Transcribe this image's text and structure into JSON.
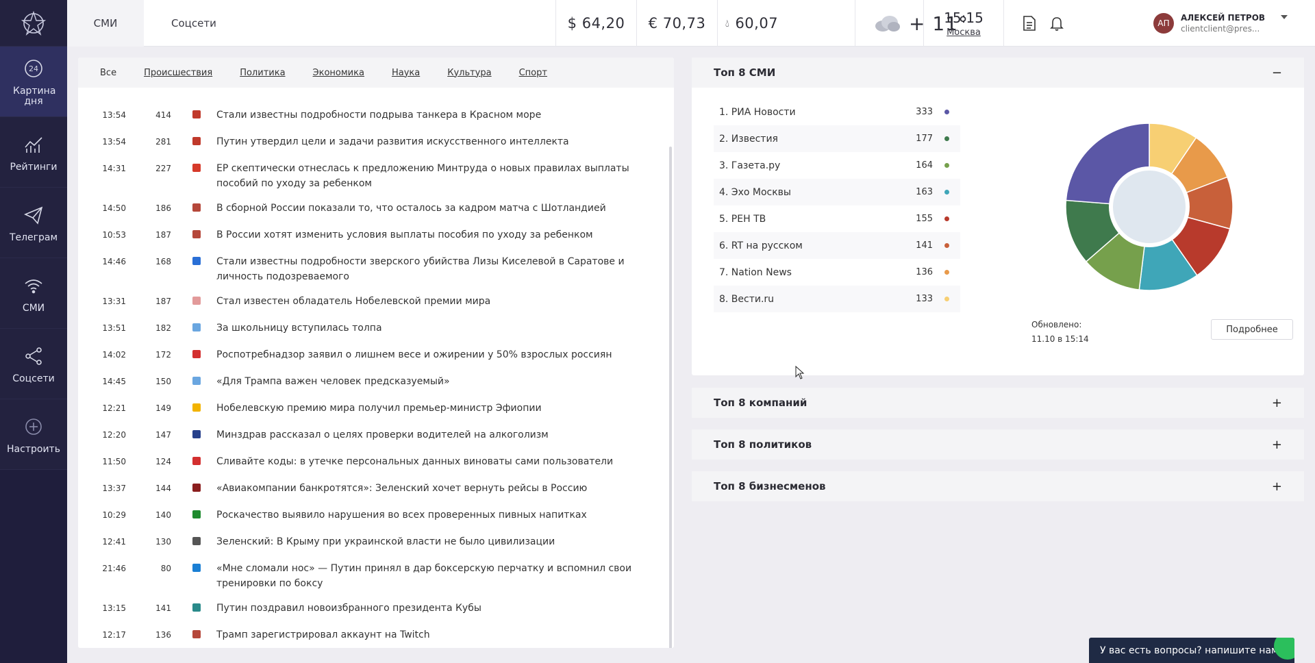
{
  "sidebar": {
    "items": [
      {
        "label": "Картина дня",
        "icon": "clock-24-icon",
        "active": true
      },
      {
        "label": "Рейтинги",
        "icon": "chart-icon"
      },
      {
        "label": "Телеграм",
        "icon": "telegram-icon"
      },
      {
        "label": "СМИ",
        "icon": "wifi-icon"
      },
      {
        "label": "Соцсети",
        "icon": "share-icon"
      },
      {
        "label": "Настроить",
        "icon": "plus-circle-icon"
      }
    ]
  },
  "header": {
    "tabs": [
      {
        "label": "СМИ"
      },
      {
        "label": "Соцсети"
      }
    ],
    "usd": "$ 64,20",
    "eur": "€ 70,73",
    "oil": "60,07",
    "weather_temp": "+ 11°",
    "time": "15:15",
    "city": "Москва",
    "user_initials": "АП",
    "user_name": "АЛЕКСЕЙ ПЕТРОВ",
    "user_email": "clientclient@pres..."
  },
  "news": {
    "categories": [
      "Все",
      "Происшествия",
      "Политика",
      "Экономика",
      "Наука",
      "Культура",
      "Спорт"
    ],
    "items": [
      {
        "time": "13:54",
        "count": "414",
        "color": "#c0392b",
        "title": "Стали известны подробности подрыва танкера в Красном море"
      },
      {
        "time": "13:54",
        "count": "281",
        "color": "#c0392b",
        "title": "Путин утвердил цели и задачи развития искусственного интеллекта"
      },
      {
        "time": "14:31",
        "count": "227",
        "color": "#d63a2a",
        "title": "ЕР скептически отнеслась к предложению Минтруда о новых правилах выплаты пособий по уходу за ребенком"
      },
      {
        "time": "14:50",
        "count": "186",
        "color": "#b5473a",
        "title": "В сборной России показали то, что осталось за кадром матча с Шотландией"
      },
      {
        "time": "10:53",
        "count": "187",
        "color": "#b5473a",
        "title": "В России хотят изменить условия выплаты пособия по уходу за ребенком"
      },
      {
        "time": "14:46",
        "count": "168",
        "color": "#2a6fd6",
        "title": "Стали известны подробности зверского убийства Лизы Киселевой в Саратове и личность подозреваемого"
      },
      {
        "time": "13:31",
        "count": "187",
        "color": "#e29a9a",
        "title": "Стал известен обладатель Нобелевской премии мира"
      },
      {
        "time": "13:51",
        "count": "182",
        "color": "#6aa6e0",
        "title": "За школьницу вступилась толпа"
      },
      {
        "time": "14:02",
        "count": "172",
        "color": "#d32f2f",
        "title": "Роспотребнадзор заявил о лишнем весе и ожирении у 50% взрослых россиян"
      },
      {
        "time": "14:45",
        "count": "150",
        "color": "#6aa6e0",
        "title": "«Для Трампа важен человек предсказуемый»"
      },
      {
        "time": "12:21",
        "count": "149",
        "color": "#f2b300",
        "title": "Нобелевскую премию мира получил премьер-министр Эфиопии"
      },
      {
        "time": "12:20",
        "count": "147",
        "color": "#27408b",
        "title": "Минздрав рассказал о целях проверки водителей на алкоголизм"
      },
      {
        "time": "11:50",
        "count": "124",
        "color": "#d32f2f",
        "title": "Сливайте коды: в утечке персональных данных виноваты сами пользователи"
      },
      {
        "time": "13:37",
        "count": "144",
        "color": "#8b1e1e",
        "title": "«Авиакомпании банкротятся»: Зеленский хочет вернуть рейсы в Россию"
      },
      {
        "time": "10:29",
        "count": "140",
        "color": "#1e8a2e",
        "title": "Роскачество выявило нарушения во всех проверенных пивных напитках"
      },
      {
        "time": "12:41",
        "count": "130",
        "color": "#555555",
        "title": "Зеленский: В Крыму при украинской власти не было цивилизации"
      },
      {
        "time": "21:46",
        "count": "80",
        "color": "#1a7fd4",
        "title": "«Мне сломали нос» — Путин принял в дар боксерскую перчатку и вспомнил свои тренировки по боксу"
      },
      {
        "time": "13:15",
        "count": "141",
        "color": "#2a8a8a",
        "title": "Путин поздравил новоизбранного президента Кубы"
      },
      {
        "time": "12:17",
        "count": "136",
        "color": "#b5473a",
        "title": "Трамп зарегистрировал аккаунт на Twitch"
      }
    ]
  },
  "top_media": {
    "title": "Топ 8 СМИ",
    "toggle": "−",
    "items": [
      {
        "name": "1. РИА Новости",
        "value": "333",
        "color": "#5b57a6"
      },
      {
        "name": "2. Известия",
        "value": "177",
        "color": "#3f7a4d"
      },
      {
        "name": "3. Газета.ру",
        "value": "164",
        "color": "#76a04c"
      },
      {
        "name": "4. Эхо Москвы",
        "value": "163",
        "color": "#3fa6b8"
      },
      {
        "name": "5. РЕН ТВ",
        "value": "155",
        "color": "#b83a2c"
      },
      {
        "name": "6. RT на русском",
        "value": "141",
        "color": "#c8603a"
      },
      {
        "name": "7. Nation News",
        "value": "136",
        "color": "#e89a4a"
      },
      {
        "name": "8. Вести.ru",
        "value": "133",
        "color": "#f7cf73"
      }
    ],
    "updated_label": "Обновлено:",
    "updated_value": "11.10 в 15:14",
    "more_label": "Подробнее"
  },
  "collapsed_panels": [
    {
      "title": "Топ 8 компаний",
      "toggle": "+"
    },
    {
      "title": "Топ 8 политиков",
      "toggle": "+"
    },
    {
      "title": "Топ 8 бизнесменов",
      "toggle": "+"
    }
  ],
  "chat": {
    "label": "У вас есть вопросы? напишите нам!"
  },
  "chart_data": {
    "type": "pie",
    "categories": [
      "РИА Новости",
      "Известия",
      "Газета.ру",
      "Эхо Москвы",
      "РЕН ТВ",
      "RT на русском",
      "Nation News",
      "Вести.ru"
    ],
    "values": [
      333,
      177,
      164,
      163,
      155,
      141,
      136,
      133
    ],
    "colors": [
      "#5b57a6",
      "#3f7a4d",
      "#76a04c",
      "#3fa6b8",
      "#b83a2c",
      "#c8603a",
      "#e89a4a",
      "#f7cf73"
    ]
  }
}
